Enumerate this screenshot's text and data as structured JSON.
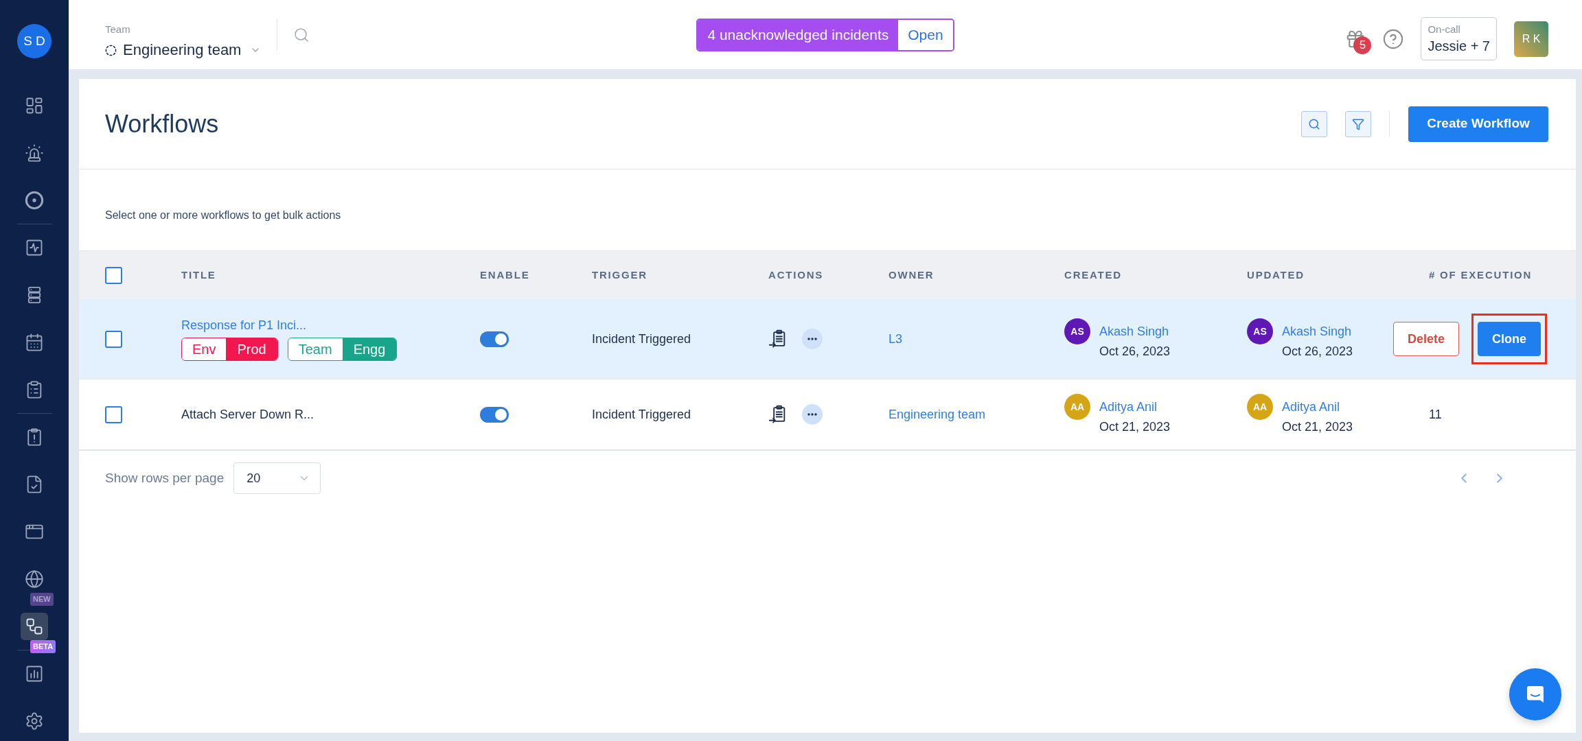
{
  "sidebar": {
    "avatar": "S D",
    "groups": [
      {
        "items": [
          {
            "selected": false
          },
          {
            "selected": false
          },
          {
            "selected": false
          }
        ]
      },
      {
        "items": [
          {
            "selected": false
          },
          {
            "selected": false
          },
          {
            "selected": false
          },
          {
            "selected": false
          }
        ]
      },
      {
        "items": [
          {
            "selected": false
          },
          {
            "selected": false
          },
          {
            "selected": false
          },
          {
            "selected": false,
            "badge": "NEW"
          },
          {
            "selected": true,
            "badge": "BETA"
          }
        ]
      },
      {
        "items": [
          {
            "selected": false
          },
          {
            "selected": false
          }
        ]
      }
    ]
  },
  "top_bar": {
    "team_label": "Team",
    "team_name": "Engineering team",
    "incidents": {
      "message": "4 unacknowledged incidents",
      "action": "Open"
    },
    "gift_count": "5",
    "on_call": {
      "label": "On-call",
      "value": "Jessie + 7"
    },
    "user_initials": "R K"
  },
  "page": {
    "title": "Workflows",
    "create_button": "Create Workflow",
    "bulk_hint": "Select one or more workflows to get bulk actions"
  },
  "table": {
    "select_all": {
      "checked": false
    },
    "columns": [
      "TITLE",
      "ENABLE",
      "TRIGGER",
      "ACTIONS",
      "OWNER",
      "CREATED",
      "UPDATED",
      "# OF EXECUTION"
    ],
    "rows": [
      {
        "checked": false,
        "hovered": true,
        "title": "Response for P1 Inci...",
        "tags": [
          {
            "key": "Env",
            "value": "Prod",
            "color": "#f2174f"
          },
          {
            "key": "Team",
            "value": "Engg",
            "color": "#17a58c"
          }
        ],
        "enabled": true,
        "trigger": "Incident Triggered",
        "owner": "L3",
        "created": {
          "initials": "AS",
          "name": "Akash Singh",
          "date": "Oct 26, 2023",
          "color": "#5f17b5"
        },
        "updated": {
          "initials": "AS",
          "name": "Akash Singh",
          "date": "Oct 26, 2023",
          "color": "#5f17b5"
        },
        "row_actions": [
          {
            "label": "Delete",
            "kind": "outline",
            "highlighted": false
          },
          {
            "label": "Clone",
            "kind": "primary",
            "highlighted": true
          }
        ]
      },
      {
        "checked": false,
        "hovered": false,
        "title": "Attach Server Down R...",
        "enabled": true,
        "trigger": "Incident Triggered",
        "owner": "Engineering team",
        "created": {
          "initials": "AA",
          "name": "Aditya Anil",
          "date": "Oct 21, 2023",
          "color": "#d6a516"
        },
        "updated": {
          "initials": "AA",
          "name": "Aditya Anil",
          "date": "Oct 21, 2023",
          "color": "#d6a516"
        },
        "executions": "11"
      }
    ]
  },
  "footer": {
    "rows_label": "Show rows per page",
    "rows_per_page": "20"
  }
}
